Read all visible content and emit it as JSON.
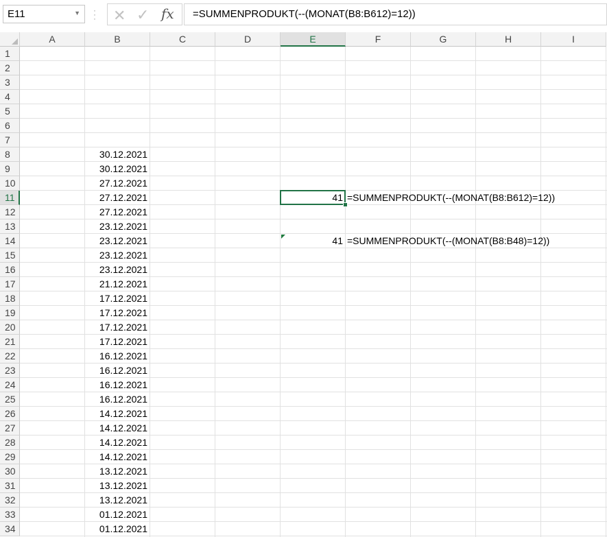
{
  "name_box": {
    "value": "E11"
  },
  "formula_bar": {
    "value": "=SUMMENPRODUKT(--(MONAT(B8:B612)=12))"
  },
  "columns": [
    "A",
    "B",
    "C",
    "D",
    "E",
    "F",
    "G",
    "H",
    "I"
  ],
  "active_column": "E",
  "active_row": "11",
  "rows": [
    "1",
    "2",
    "3",
    "4",
    "5",
    "6",
    "7",
    "8",
    "9",
    "10",
    "11",
    "12",
    "13",
    "14",
    "15",
    "16",
    "17",
    "18",
    "19",
    "20",
    "21",
    "22",
    "23",
    "24",
    "25",
    "26",
    "27",
    "28",
    "29",
    "30",
    "31",
    "32",
    "33",
    "34"
  ],
  "column_b_dates": [
    {
      "row": "8",
      "value": "30.12.2021"
    },
    {
      "row": "9",
      "value": "30.12.2021"
    },
    {
      "row": "10",
      "value": "27.12.2021"
    },
    {
      "row": "11",
      "value": "27.12.2021"
    },
    {
      "row": "12",
      "value": "27.12.2021"
    },
    {
      "row": "13",
      "value": "23.12.2021"
    },
    {
      "row": "14",
      "value": "23.12.2021"
    },
    {
      "row": "15",
      "value": "23.12.2021"
    },
    {
      "row": "16",
      "value": "23.12.2021"
    },
    {
      "row": "17",
      "value": "21.12.2021"
    },
    {
      "row": "18",
      "value": "17.12.2021"
    },
    {
      "row": "19",
      "value": "17.12.2021"
    },
    {
      "row": "20",
      "value": "17.12.2021"
    },
    {
      "row": "21",
      "value": "17.12.2021"
    },
    {
      "row": "22",
      "value": "16.12.2021"
    },
    {
      "row": "23",
      "value": "16.12.2021"
    },
    {
      "row": "24",
      "value": "16.12.2021"
    },
    {
      "row": "25",
      "value": "16.12.2021"
    },
    {
      "row": "26",
      "value": "14.12.2021"
    },
    {
      "row": "27",
      "value": "14.12.2021"
    },
    {
      "row": "28",
      "value": "14.12.2021"
    },
    {
      "row": "29",
      "value": "14.12.2021"
    },
    {
      "row": "30",
      "value": "13.12.2021"
    },
    {
      "row": "31",
      "value": "13.12.2021"
    },
    {
      "row": "32",
      "value": "13.12.2021"
    },
    {
      "row": "33",
      "value": "01.12.2021"
    },
    {
      "row": "34",
      "value": "01.12.2021"
    }
  ],
  "results": [
    {
      "cell": "E11",
      "value": "41",
      "formula_text": "=SUMMENPRODUKT(--(MONAT(B8:B612)=12))"
    },
    {
      "cell": "E14",
      "value": "41",
      "formula_text": "=SUMMENPRODUKT(--(MONAT(B8:B48)=12))"
    }
  ],
  "colors": {
    "accent": "#217346",
    "gridline": "#e1e1e1",
    "header_bg": "#f3f3f3"
  }
}
